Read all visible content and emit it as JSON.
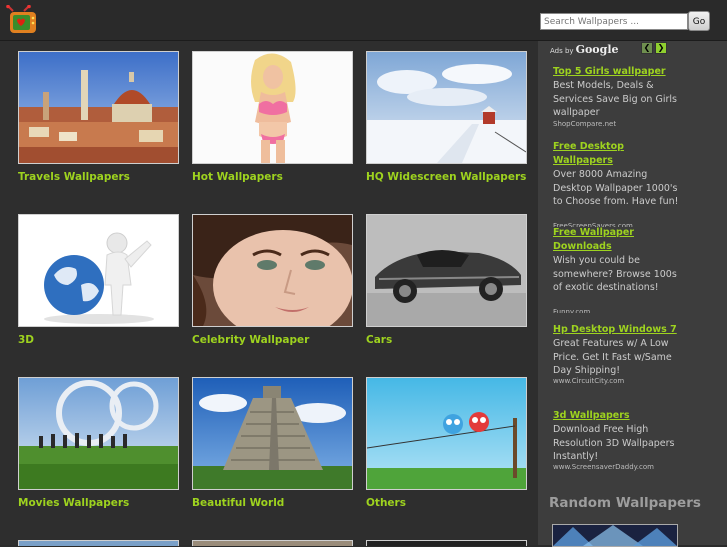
{
  "search": {
    "placeholder": "Search Wallpapers ...",
    "button": "Go"
  },
  "gallery": [
    {
      "caption": "Travels Wallpapers"
    },
    {
      "caption": "Hot Wallpapers"
    },
    {
      "caption": "HQ Widescreen Wallpapers"
    },
    {
      "caption": "3D"
    },
    {
      "caption": "Celebrity Wallpaper"
    },
    {
      "caption": "Cars"
    },
    {
      "caption": "Movies Wallpapers"
    },
    {
      "caption": "Beautiful World"
    },
    {
      "caption": "Others"
    }
  ],
  "ads": {
    "header_prefix": "Ads by",
    "header_brand": "Google",
    "items": [
      {
        "title_lines": [
          "Top 5 Girls wallpaper"
        ],
        "body": "Best Models, Deals & Services Save Big on Girls wallpaper",
        "url": "ShopCompare.net"
      },
      {
        "title_lines": [
          "Free Desktop",
          "Wallpapers"
        ],
        "body": "Over 8000 Amazing Desktop Wallpaper 1000's to Choose from. Have fun!",
        "url": "FreeScreenSavers.com"
      },
      {
        "title_lines": [
          "Free Wallpaper",
          "Downloads"
        ],
        "body": "Wish you could be somewhere? Browse 100s of exotic destinations!",
        "url": "Funny.com"
      },
      {
        "title_lines": [
          "Hp Desktop Windows 7"
        ],
        "body": "Great Features w/ A Low Price. Get It Fast w/Same Day Shipping!",
        "url": "www.CircuitCity.com"
      },
      {
        "title_lines": [
          "3d Wallpapers"
        ],
        "body": "Download Free High Resolution 3D Wallpapers Instantly!",
        "url": "www.ScreensaverDaddy.com"
      }
    ]
  },
  "random": {
    "heading": "Random Wallpapers"
  },
  "colors": {
    "accent": "#9ed31f",
    "background": "#2b2b2b",
    "sidebar": "#3d3d3d"
  }
}
